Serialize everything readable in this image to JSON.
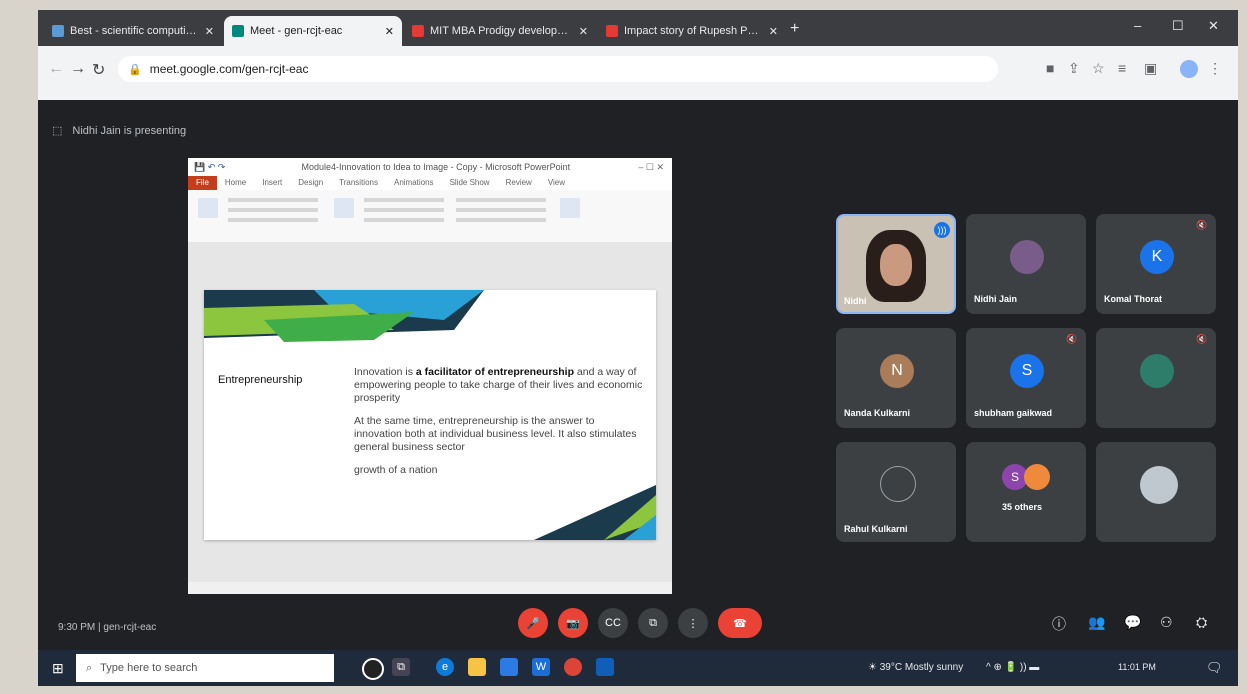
{
  "browser": {
    "tabs": [
      {
        "label": "Best - scientific computing with..."
      },
      {
        "label": "Meet - gen-rcjt-eac"
      },
      {
        "label": "MIT MBA Prodigy developer..."
      },
      {
        "label": "Impact story of Rupesh Patel -"
      }
    ],
    "new_tab": "+",
    "url": "meet.google.com/gen-rcjt-eac",
    "window_controls": {
      "minimize": "–",
      "maximize": "☐",
      "close": "✕"
    }
  },
  "meet": {
    "presenting_label": "Nidhi Jain is presenting",
    "presentation": {
      "window_title": "Module4-Innovation to Idea to Image - Copy - Microsoft PowerPoint",
      "ribbon_tabs": [
        "File",
        "Home",
        "Insert",
        "Design",
        "Transitions",
        "Animations",
        "Slide Show",
        "Review",
        "View"
      ],
      "slide": {
        "heading": "Entrepreneurship",
        "para1_prefix": "Innovation is ",
        "para1_bold": "a facilitator of entrepreneurship",
        "para1_suffix": " and a way of empowering people to take charge of their lives and economic prosperity",
        "para2": "At the same time, entrepreneurship is the answer to innovation both at individual business level. It also stimulates general business sector",
        "para3": "growth of a nation"
      }
    },
    "participants": [
      {
        "name": "Nidhi",
        "initial": "",
        "color": "#c8c1b4"
      },
      {
        "name": "Nidhi Jain",
        "initial": "",
        "color": "#7a5c8a"
      },
      {
        "name": "Komal Thorat",
        "initial": "K",
        "color": "#1a73e8"
      },
      {
        "name": "Nanda Kulkarni",
        "initial": "N",
        "color": "#a97c5a"
      },
      {
        "name": "shubham gaikwad",
        "initial": "S",
        "color": "#1a73e8"
      },
      {
        "name": "",
        "initial": "",
        "color": "#2e7d6a"
      },
      {
        "name": "Rahul Kulkarni",
        "initial": "",
        "color": "#3c4043"
      },
      {
        "name": "35 others",
        "initial": "S",
        "color": "#8e44ad"
      },
      {
        "name": "",
        "initial": "",
        "color": "#bfc7cf"
      }
    ],
    "time_code": "9:30 PM  |  gen-rcjt-eac",
    "controls": {
      "mic": "🎤",
      "camera": "📷",
      "captions": "CC",
      "present": "⧉",
      "more": "⋮",
      "hangup": "☎"
    },
    "right_icons": [
      "ⓘ",
      "👥",
      "💬",
      "⚇",
      "⛭"
    ]
  },
  "taskbar": {
    "search_placeholder": "Type here to search",
    "weather": "39°C  Mostly sunny",
    "tray": "^  ⊕  🔋  ))  ▬",
    "clock": "11:01 PM"
  }
}
